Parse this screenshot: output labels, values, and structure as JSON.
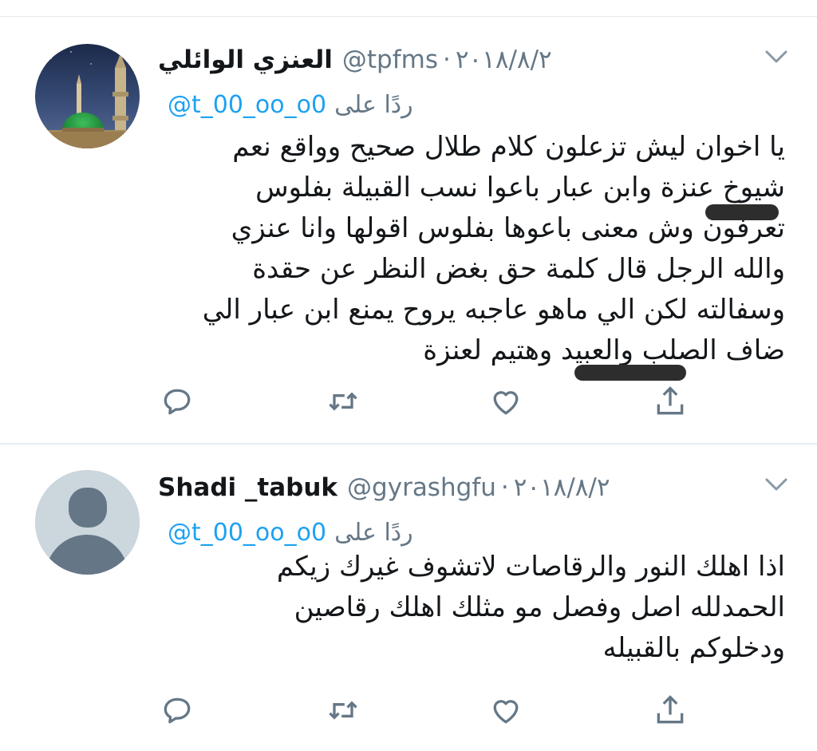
{
  "tweets": [
    {
      "author_name": "العنزي الوائلي",
      "handle": "@tpfms",
      "separator": "·",
      "date": "٢٠١٨/٨/٢",
      "reply_label": "ردًا على",
      "reply_mention": "@t_00_oo_o0",
      "text_lines": [
        "يا اخوان ليش تزعلون كلام طلال صحيح وواقع نعم",
        "شيوخ عنزة وابن عبار باعوا نسب القبيلة بفلوس",
        "تعرفون وش معنى باعوها بفلوس اقولها وانا عنزي",
        "والله الرجل قال كلمة حق بغض النظر عن حقدة",
        "وسفالته لكن الي ماهو عاجبه يروح يمنع ابن عبار الي",
        "ضاف الصلب والعبيد وهتيم لعنزة"
      ],
      "avatar_icon": "mosque-dome-photo"
    },
    {
      "author_name": "Shadi _tabuk",
      "handle": "@gyrashgfu",
      "separator": "·",
      "date": "٢٠١٨/٨/٢",
      "reply_label": "ردًا على",
      "reply_mention": "@t_00_oo_o0",
      "text_lines": [
        "اذا اهلك النور والرقاصات لاتشوف غيرك زيكم",
        "الحمدلله اصل وفصل مو مثلك اهلك رقاصين",
        "ودخلوكم بالقبيله"
      ],
      "avatar_icon": "default-user-icon"
    }
  ],
  "actions": [
    "reply-icon",
    "retweet-icon",
    "like-icon",
    "share-icon"
  ],
  "colors": {
    "accent": "#1da1f2",
    "secondary_text": "#657786",
    "icon": "#657786",
    "divider": "#e6ecf0",
    "redaction": "#2d2d2d"
  }
}
